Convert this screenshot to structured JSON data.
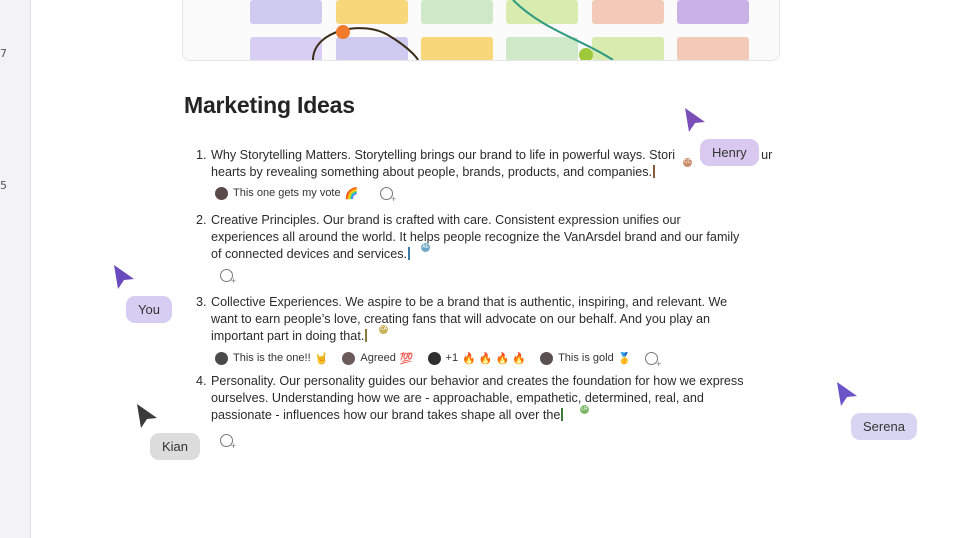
{
  "rail": {
    "num_top": "7",
    "num_mid": "5"
  },
  "page_title": "Marketing Ideas",
  "items": [
    {
      "num": "1.",
      "text": "Why Storytelling Matters. Storytelling brings our brand to life in powerful ways. Stori... hearts by revealing something about people, brands, products, and companies."
    },
    {
      "num": "2.",
      "text": "Creative Principles. Our brand is crafted with care. Consistent expression unifies our experiences all around the world. It helps people recognize the VanArsdel brand and our family of connected devices and services."
    },
    {
      "num": "3.",
      "text": "Collective Experiences. We aspire to be a brand that is authentic, inspiring, and relevant. We want to earn people’s love, creating fans that will advocate on our behalf. And you play an important part in doing that."
    },
    {
      "num": "4.",
      "text": "Personality. Our personality guides our behavior and creates the foundation for how we express ourselves. Understanding how we are - approachable, empathetic, determined, real, and passionate - influences how our brand takes shape all over the"
    }
  ],
  "item1_lines": [
    "Why Storytelling Matters. Storytelling brings our brand to life in powerful ways. Stori",
    "ur",
    "hearts by revealing something about people, brands, products, and companies."
  ],
  "item2_lines": [
    "Creative Principles. Our brand is crafted with care. Consistent expression unifies our",
    "experiences all around the world. It helps people recognize the VanArsdel brand and our family",
    "of connected devices and services."
  ],
  "item3_lines": [
    "Collective Experiences. We aspire to be a brand that is authentic, inspiring, and relevant. We",
    "want to earn people’s love, creating fans that will advocate on our behalf. And you play an",
    "important part in doing that."
  ],
  "item4_lines": [
    "Personality. Our personality guides our behavior and creates the foundation for how we express",
    "ourselves. Understanding how we are - approachable, empathetic, determined, real, and",
    "passionate - influences how our brand takes shape all over the"
  ],
  "reactions1": [
    {
      "label": "This one gets my vote",
      "emoji": "🌈"
    }
  ],
  "reactions3": [
    {
      "label": "This is the one!!",
      "emoji": "🤘"
    },
    {
      "label": "Agreed",
      "emoji": "💯"
    },
    {
      "label": "+1",
      "emoji": "🔥 🔥 🔥 🔥"
    },
    {
      "label": "This is gold",
      "emoji": "🥇"
    }
  ],
  "cursors": {
    "henry": {
      "name": "Henry",
      "color": "#7b4fb8",
      "tag_bg": "#d9c9f0"
    },
    "you": {
      "name": "You",
      "color": "#6a4bbd",
      "tag_bg": "#d7cdf3"
    },
    "serena": {
      "name": "Serena",
      "color": "#6a54c8",
      "tag_bg": "#d8d5f2"
    },
    "kian": {
      "name": "Kian",
      "color": "#3a3a3a",
      "tag_bg": "#dcdcdc"
    }
  },
  "badges": {
    "b1": "CC",
    "b2": "AE",
    "b3": "CA",
    "b4": "LR"
  }
}
